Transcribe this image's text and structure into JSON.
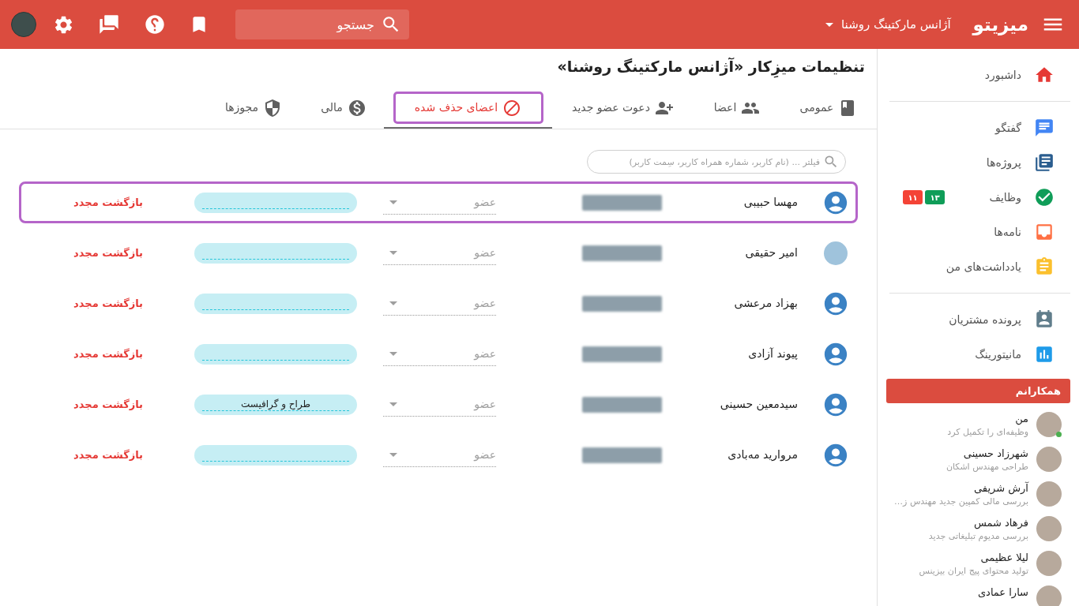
{
  "topbar": {
    "logo": "میزیتو",
    "workspace": "آژانس مارکتینگ روشنا",
    "search": {
      "placeholder": "جستجو"
    }
  },
  "page": {
    "title": "تنظیمات میزِکار «آژانس مارکتینگ روشنا»"
  },
  "tabs": [
    {
      "label": "عمومی",
      "selected": false,
      "highlighted": false
    },
    {
      "label": "اعضا",
      "selected": false,
      "highlighted": false
    },
    {
      "label": "دعوت عضو جدید",
      "selected": false,
      "highlighted": false
    },
    {
      "label": "اعضای حذف شده",
      "selected": true,
      "highlighted": true
    },
    {
      "label": "مالی",
      "selected": false,
      "highlighted": false
    },
    {
      "label": "مجوزها",
      "selected": false,
      "highlighted": false
    }
  ],
  "filter": {
    "placeholder": "فیلتر ... (نام کاربر، شماره همراه کاربر، سِمت کاربر)"
  },
  "members": [
    {
      "kind": "placeholder",
      "name": "مهسا حبیبی",
      "role": "عضو",
      "action": "بازگشت مجدد",
      "highlighted": true
    },
    {
      "kind": "photo",
      "name": "امیر حقیقی",
      "role": "عضو",
      "action": "بازگشت مجدد",
      "highlighted": false
    },
    {
      "kind": "placeholder",
      "name": "بهزاد مرعشی",
      "role": "عضو",
      "action": "بازگشت مجدد",
      "highlighted": false
    },
    {
      "kind": "placeholder",
      "name": "پیوند آزادی",
      "role": "عضو",
      "action": "بازگشت مجدد",
      "highlighted": false
    },
    {
      "kind": "placeholder",
      "name": "سیدمعین حسینی",
      "role": "عضو",
      "job_title": "طراح و گرافیست",
      "action": "بازگشت مجدد",
      "highlighted": false
    },
    {
      "kind": "placeholder",
      "name": "مروارید مه‌بادی",
      "role": "عضو",
      "action": "بازگشت مجدد",
      "highlighted": false
    }
  ],
  "sidebar": {
    "sections": [
      {
        "items": [
          {
            "label": "داشبورد"
          }
        ]
      },
      {
        "items": [
          {
            "label": "گفتگو"
          },
          {
            "label": "پروژه‌ها"
          },
          {
            "label": "وظایف",
            "badges": [
              {
                "text": "۱۳",
                "color": "#0f9d58"
              },
              {
                "text": "۱۱",
                "color": "#f44336"
              }
            ]
          },
          {
            "label": "نامه‌ها"
          },
          {
            "label": "یادداشت‌های من"
          }
        ]
      },
      {
        "items": [
          {
            "label": "پرونده مشتریان"
          },
          {
            "label": "مانیتورینگ"
          }
        ]
      }
    ],
    "colleagues": {
      "title": "همکارانم",
      "people": [
        {
          "name": "من",
          "status": "وظیفه‌ای را تکمیل کرد",
          "online": true
        },
        {
          "name": "شهرزاد حسینی",
          "status": "طراحی مهندس اشکان",
          "online": false
        },
        {
          "name": "آرش شریفی",
          "status": "بررسی مالی کمپین جدید مهندس ز…",
          "online": false
        },
        {
          "name": "فرهاد شمس",
          "status": "بررسی مدیوم تبلیغاتی جدید",
          "online": false
        },
        {
          "name": "لیلا عظیمی",
          "status": "تولید محتوای پیج ایران بیزینس",
          "online": false
        },
        {
          "name": "سارا عمادی",
          "online": false
        }
      ]
    }
  }
}
